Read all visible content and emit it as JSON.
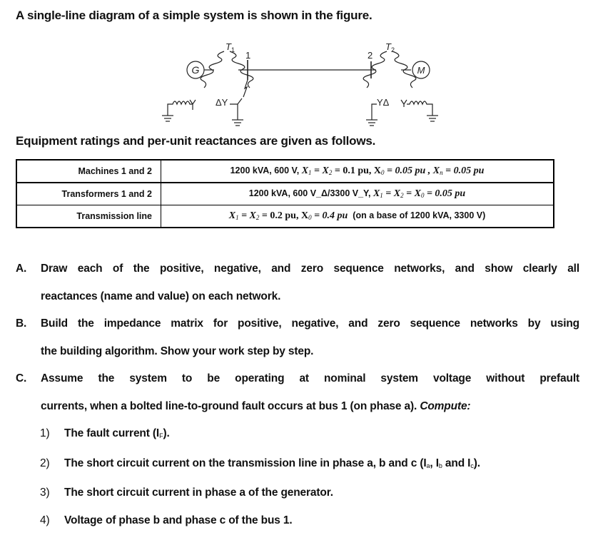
{
  "title": "A single-line diagram of a simple system is shown in the figure.",
  "diagram": {
    "generator_label": "G",
    "motor_label": "M",
    "transformer1_label": "T",
    "transformer1_sub": "1",
    "transformer2_label": "T",
    "transformer2_sub": "2",
    "bus1_label": "1",
    "bus2_label": "2",
    "t1_connection": "ΔY",
    "t2_connection": "YΔ",
    "gen_connection": "Y",
    "motor_connection": "Y"
  },
  "subtitle": "Equipment ratings and per-unit reactances are given as follows.",
  "table": {
    "rows": [
      {
        "label": "Machines 1 and 2",
        "rating": "1200 kVA, 600 V, ",
        "eq1": "X",
        "eq1_sub": "1",
        "eq2": " = X",
        "eq2_sub": "2",
        "eq3": " = 0.1 pu,    X",
        "eq3_sub": "0",
        "eq4": " = 0.05 pu , X",
        "eq4_sub": "n",
        "eq5": " = 0.05 pu"
      },
      {
        "label": "Transformers 1 and 2",
        "rating": "1200 kVA, 600 V_Δ/3300 V_Y, ",
        "eq1": "X",
        "eq1_sub": "1",
        "eq2": " = X",
        "eq2_sub": "2",
        "eq3": " = X",
        "eq3_sub": "0",
        "eq4": " = 0.05 pu"
      },
      {
        "label": "Transmission line",
        "eq1": "X",
        "eq1_sub": "1",
        "eq2": " = X",
        "eq2_sub": "2",
        "eq3": " = 0.2 pu,  X",
        "eq3_sub": "0",
        "eq4": " = 0.4 pu",
        "note": "  (on a base of 1200 kVA, 3300 V)"
      }
    ]
  },
  "questions": [
    {
      "letter": "A.",
      "lines": [
        "Draw each of the positive, negative, and zero sequence networks, and show clearly all",
        "reactances (name and value) on each network."
      ]
    },
    {
      "letter": "B.",
      "lines": [
        "Build the impedance matrix for positive, negative, and zero sequence networks by using",
        "the building algorithm. Show your work step by step."
      ]
    },
    {
      "letter": "C.",
      "lines": [
        "Assume the system to be operating at nominal system voltage without prefault",
        "currents, when a bolted line-to-ground fault occurs at bus 1 (on phase a). "
      ],
      "emphasis": "Compute:",
      "items": [
        {
          "num": "1)",
          "text": "The fault current (I",
          "sub": "F",
          "tail": ")."
        },
        {
          "num": "2)",
          "text": "The short circuit current on the transmission line in phase a, b and c (I",
          "sub_a": "a",
          "mid1": ", I",
          "sub_b": "b",
          "mid2": " and I",
          "sub_c": "c",
          "tail": ")."
        },
        {
          "num": "3)",
          "text": "The short circuit current in phase a of the generator."
        },
        {
          "num": "4)",
          "text": "Voltage of phase b and phase c of the bus 1."
        }
      ]
    }
  ]
}
